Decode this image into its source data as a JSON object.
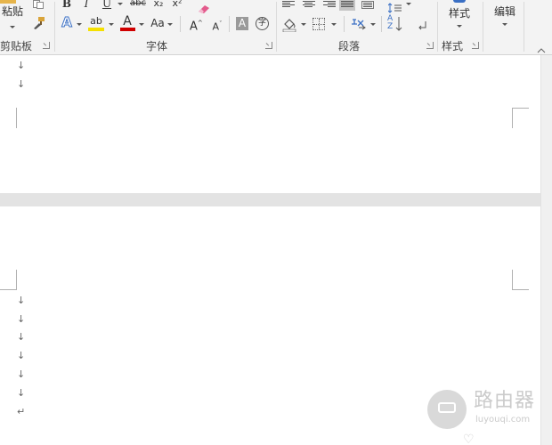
{
  "ribbon": {
    "clipboard": {
      "label": "剪贴板",
      "paste_label": "粘贴"
    },
    "font": {
      "label": "字体",
      "bold": "B",
      "italic": "I",
      "underline": "U",
      "strikethrough": "abc",
      "subscript": "x₂",
      "superscript": "x²",
      "text_effects": "A",
      "highlight": "ab",
      "font_color": "A",
      "change_case": "Aa",
      "grow_font": "A",
      "shrink_font": "A",
      "char_shading": "A",
      "enclose_char": "字",
      "highlight_color": "#f5e000",
      "font_color_value": "#d00000"
    },
    "paragraph": {
      "label": "段落",
      "sort": "A",
      "sort_z": "Z"
    },
    "styles": {
      "label": "样式",
      "button_label": "样式"
    },
    "editing": {
      "button_label": "编辑"
    }
  },
  "document": {
    "page1_marks": [
      "↓",
      "↓"
    ],
    "page2_marks": [
      "↓",
      "↓",
      "↓",
      "↓",
      "↓",
      "↓",
      "↵"
    ]
  },
  "watermark": {
    "title": "路由器",
    "subtitle": "luyouqi.com"
  }
}
